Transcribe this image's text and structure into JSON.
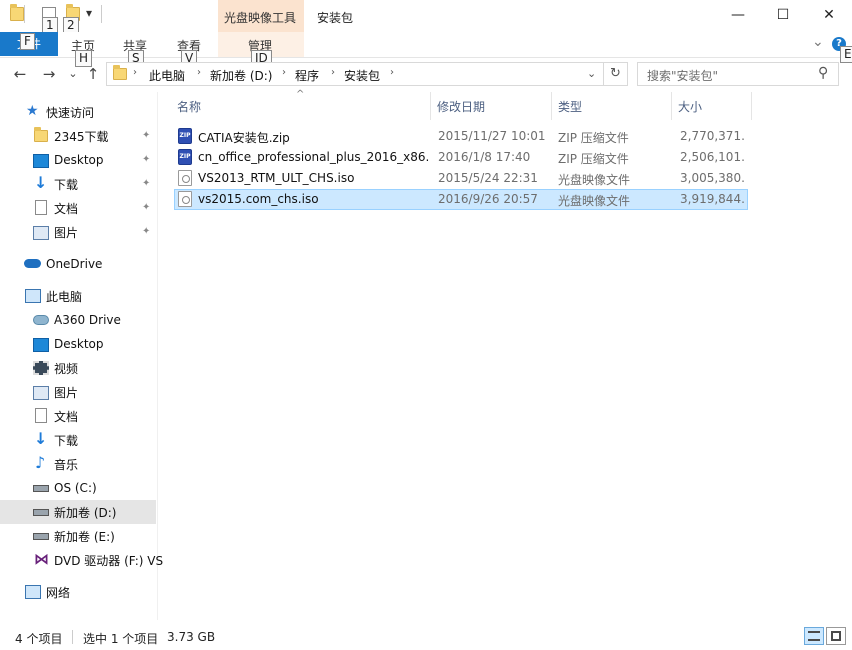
{
  "window": {
    "title": "安装包",
    "context_tab_title": "光盘映像工具",
    "minimize": "—",
    "maximize": "☐",
    "close": "✕"
  },
  "quick_access_toolbar": {
    "keytips": [
      "1",
      "2"
    ],
    "dropdown": "▾"
  },
  "ribbon": {
    "file_label": "文件",
    "file_keytip": "F",
    "tabs": [
      {
        "label": "主页",
        "keytip": "H"
      },
      {
        "label": "共享",
        "keytip": "S"
      },
      {
        "label": "查看",
        "keytip": "V"
      },
      {
        "label": "管理",
        "keytip": "JD"
      }
    ],
    "collapse": "⌄",
    "help_keytip": "E",
    "help": "?"
  },
  "address_bar": {
    "back": "←",
    "forward": "→",
    "recent": "⌄",
    "up": "↑",
    "breadcrumbs": [
      "此电脑",
      "新加卷 (D:)",
      "程序",
      "安装包"
    ],
    "separator": "›",
    "dropdown": "⌄",
    "refresh": "↻",
    "search_placeholder": "搜索\"安装包\"",
    "search_icon": "⚲"
  },
  "nav_pane": {
    "items": [
      {
        "label": "快速访问",
        "icon": "star-icon"
      },
      {
        "label": "2345下载",
        "icon": "folder-icon",
        "pinned": true
      },
      {
        "label": "Desktop",
        "icon": "desktop-icon",
        "pinned": true
      },
      {
        "label": "下载",
        "icon": "download-icon",
        "pinned": true
      },
      {
        "label": "文档",
        "icon": "document-icon",
        "pinned": true
      },
      {
        "label": "图片",
        "icon": "picture-icon",
        "pinned": true
      },
      {
        "label": "OneDrive",
        "icon": "cloud-icon"
      },
      {
        "label": "此电脑",
        "icon": "computer-icon"
      },
      {
        "label": "A360 Drive",
        "icon": "a360-icon"
      },
      {
        "label": "Desktop",
        "icon": "desktop-icon"
      },
      {
        "label": "视频",
        "icon": "video-icon"
      },
      {
        "label": "图片",
        "icon": "picture-icon"
      },
      {
        "label": "文档",
        "icon": "document-icon"
      },
      {
        "label": "下载",
        "icon": "download-icon"
      },
      {
        "label": "音乐",
        "icon": "music-icon"
      },
      {
        "label": "OS (C:)",
        "icon": "os-drive-icon"
      },
      {
        "label": "新加卷 (D:)",
        "icon": "drive-icon",
        "selected": true
      },
      {
        "label": "新加卷 (E:)",
        "icon": "drive-icon"
      },
      {
        "label": "DVD 驱动器 (F:) VS",
        "icon": "dvd-icon"
      },
      {
        "label": "网络",
        "icon": "network-icon"
      }
    ],
    "pin": "📌"
  },
  "file_list": {
    "sort_arrow": "^",
    "columns": [
      "名称",
      "修改日期",
      "类型",
      "大小"
    ],
    "rows": [
      {
        "name": "CATIA安装包.zip",
        "date": "2015/11/27 10:01",
        "type": "ZIP 压缩文件",
        "size": "2,770,371...",
        "icon": "zip-icon"
      },
      {
        "name": "cn_office_professional_plus_2016_x86...",
        "date": "2016/1/8 17:40",
        "type": "ZIP 压缩文件",
        "size": "2,506,101...",
        "icon": "zip-icon"
      },
      {
        "name": "VS2013_RTM_ULT_CHS.iso",
        "date": "2015/5/24 22:31",
        "type": "光盘映像文件",
        "size": "3,005,380...",
        "icon": "iso-icon"
      },
      {
        "name": "vs2015.com_chs.iso",
        "date": "2016/9/26 20:57",
        "type": "光盘映像文件",
        "size": "3,919,844...",
        "icon": "iso-icon",
        "selected": true
      }
    ]
  },
  "status_bar": {
    "item_count": "4 个项目",
    "selection": "选中 1 个项目",
    "selection_size": "3.73 GB"
  },
  "colors": {
    "accent": "#1979ca",
    "selection": "#cce8ff",
    "context_tab": "#fbe3cf"
  }
}
